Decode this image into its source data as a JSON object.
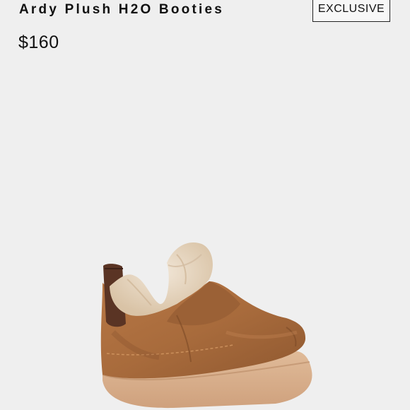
{
  "product": {
    "name": "Ardy Plush H2O Booties",
    "badge": "EXCLUSIVE",
    "price": "$160"
  },
  "image": {
    "icon": "boot-illustration",
    "colors": {
      "suede": "#a76a3b",
      "fur": "#e7d8c2",
      "heel_tab": "#5a3424",
      "sole": "#d8af8c",
      "background": "#efefef"
    }
  }
}
